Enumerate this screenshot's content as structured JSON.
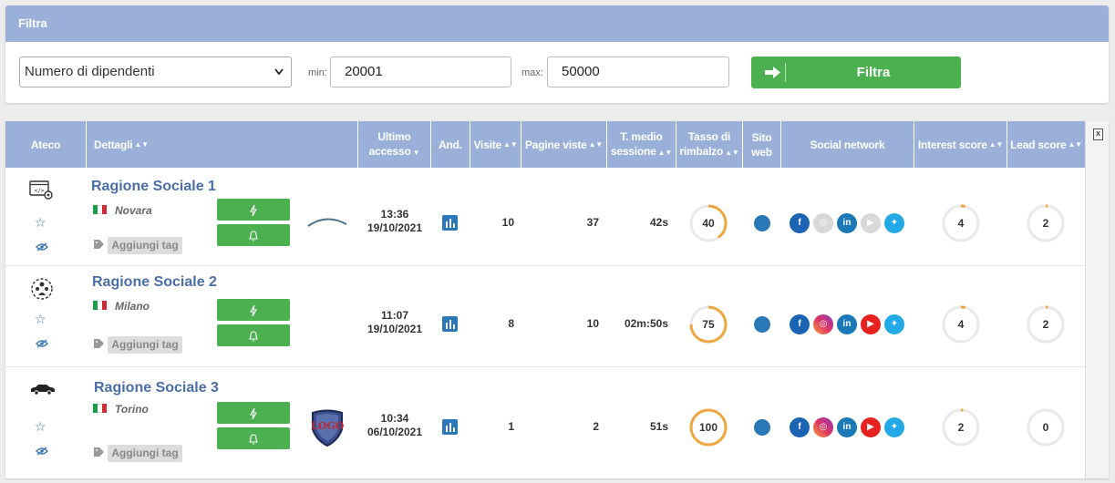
{
  "filter": {
    "title": "Filtra",
    "select_value": "Numero di dipendenti",
    "min_label": "min:",
    "min_value": "20001",
    "max_label": "max:",
    "max_value": "50000",
    "button_label": "Filtra",
    "accent": "#4caf50",
    "header_color": "#9bb0d9"
  },
  "table": {
    "columns": {
      "ateco": "Ateco",
      "dettagli": "Dettagli",
      "ultimo_1": "Ultimo",
      "ultimo_2": "accesso",
      "and": "And.",
      "visite": "Visite",
      "pagine": "Pagine viste",
      "tmedio_1": "T. medio",
      "tmedio_2": "sessione",
      "tasso_1": "Tasso di",
      "tasso_2": "rimbalzo",
      "sito_1": "Sito",
      "sito_2": "web",
      "social": "Social network",
      "interest": "Interest score",
      "lead": "Lead score"
    },
    "export_icon": "excel-icon",
    "rows": [
      {
        "company": "Ragione Sociale 1",
        "city": "Novara",
        "tag_label": "Aggiungi tag",
        "ateco_icon": "code-gear-icon",
        "time": "13:36",
        "date": "19/10/2021",
        "visite": "10",
        "pagine": "37",
        "tmedio": "42s",
        "rimbalzo": "40",
        "rimbalzo_pct": 40,
        "interest": "4",
        "interest_pct": 4,
        "lead": "2",
        "lead_pct": 2,
        "social": [
          "facebook",
          "instagram",
          "linkedin",
          "youtube",
          "twitter"
        ],
        "social_active": [
          true,
          false,
          true,
          false,
          true
        ]
      },
      {
        "company": "Ragione Sociale 2",
        "city": "Milano",
        "tag_label": "Aggiungi tag",
        "ateco_icon": "people-group-icon",
        "time": "11:07",
        "date": "19/10/2021",
        "visite": "8",
        "pagine": "10",
        "tmedio": "02m:50s",
        "rimbalzo": "75",
        "rimbalzo_pct": 75,
        "interest": "4",
        "interest_pct": 4,
        "lead": "2",
        "lead_pct": 2,
        "social": [
          "facebook",
          "instagram",
          "linkedin",
          "youtube",
          "twitter"
        ],
        "social_active": [
          true,
          true,
          true,
          true,
          true
        ]
      },
      {
        "company": "Ragione Sociale 3",
        "city": "Torino",
        "tag_label": "Aggiungi tag",
        "ateco_icon": "car-icon",
        "logo_text": "LOGO",
        "time": "10:34",
        "date": "06/10/2021",
        "visite": "1",
        "pagine": "2",
        "tmedio": "51s",
        "rimbalzo": "100",
        "rimbalzo_pct": 100,
        "interest": "2",
        "interest_pct": 2,
        "lead": "0",
        "lead_pct": 0,
        "social": [
          "facebook",
          "instagram",
          "linkedin",
          "youtube",
          "twitter"
        ],
        "social_active": [
          true,
          true,
          true,
          true,
          true
        ]
      }
    ]
  }
}
